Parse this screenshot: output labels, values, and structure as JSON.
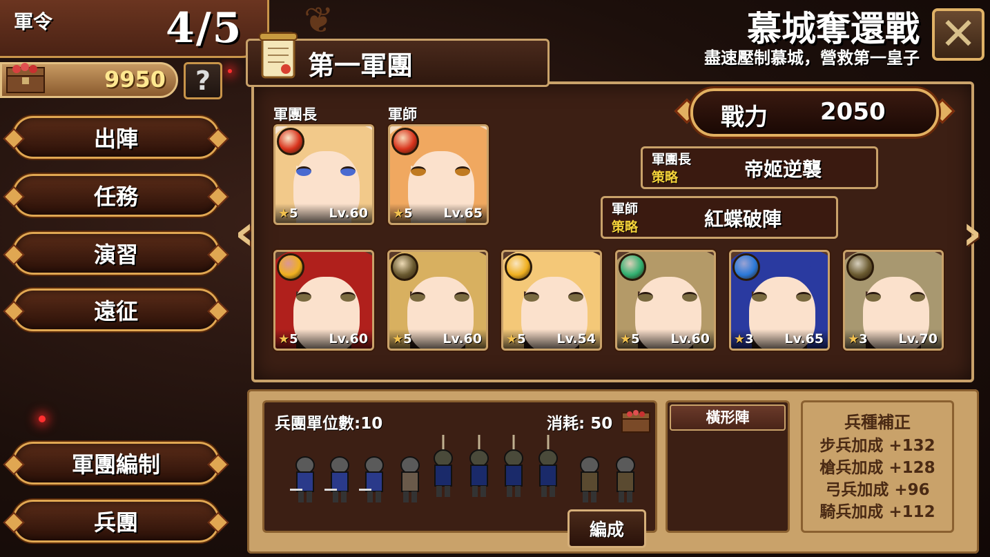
{
  "header": {
    "order_label": "軍令",
    "order_count": "4/5",
    "gold": "9950",
    "help_label": "?",
    "stage_title": "慕城奪還戰",
    "stage_subtitle": "盡速壓制慕城，營救第一皇子",
    "close_label": "✕"
  },
  "menu": {
    "sortie": "出陣",
    "mission": "任務",
    "drill": "演習",
    "expedition": "遠征",
    "legion_edit": "軍團編制",
    "troops": "兵團"
  },
  "legion": {
    "name": "第一軍團",
    "leader_label": "軍團長",
    "strategist_label": "軍師",
    "power_label": "戰力",
    "power_value": "2050",
    "leader_strategy": {
      "role": "軍團長",
      "tag": "策略",
      "name": "帝姬逆襲"
    },
    "strategist_strategy": {
      "role": "軍師",
      "tag": "策略",
      "name": "紅蝶破陣"
    },
    "leader": {
      "stars": "5",
      "level": "Lv.60",
      "element_icon": "fire-icon",
      "hair": "#f2c98a",
      "element_color": "#d8331c"
    },
    "strategist": {
      "stars": "5",
      "level": "Lv.65",
      "element_icon": "fire-icon",
      "hair": "#f0a860",
      "element_color": "#d8331c"
    },
    "members": [
      {
        "stars": "5",
        "level": "Lv.60",
        "element_icon": "light-icon",
        "hair": "#b0201c",
        "element_color": "#f0b020"
      },
      {
        "stars": "5",
        "level": "Lv.60",
        "element_icon": "earth-icon",
        "hair": "#d8b060",
        "element_color": "#6a5a30"
      },
      {
        "stars": "5",
        "level": "Lv.54",
        "element_icon": "light-icon",
        "hair": "#f4c878",
        "element_color": "#f0b020"
      },
      {
        "stars": "5",
        "level": "Lv.60",
        "element_icon": "wind-icon",
        "hair": "#b49a68",
        "element_color": "#30b070"
      },
      {
        "stars": "3",
        "level": "Lv.65",
        "element_icon": "water-icon",
        "hair": "#2a3aa0",
        "element_color": "#2a78d8"
      },
      {
        "stars": "3",
        "level": "Lv.70",
        "element_icon": "earth-icon",
        "hair": "#a89870",
        "element_color": "#6a5a30"
      }
    ]
  },
  "troops": {
    "count_label": "兵團單位數:10",
    "cost_label": "消耗: 50",
    "formation_button": "編成",
    "formation_name": "橫形陣"
  },
  "bonus": {
    "title": "兵種補正",
    "rows": [
      "步兵加成 +132",
      "槍兵加成 +128",
      "弓兵加成 +96",
      "騎兵加成 +112"
    ]
  }
}
